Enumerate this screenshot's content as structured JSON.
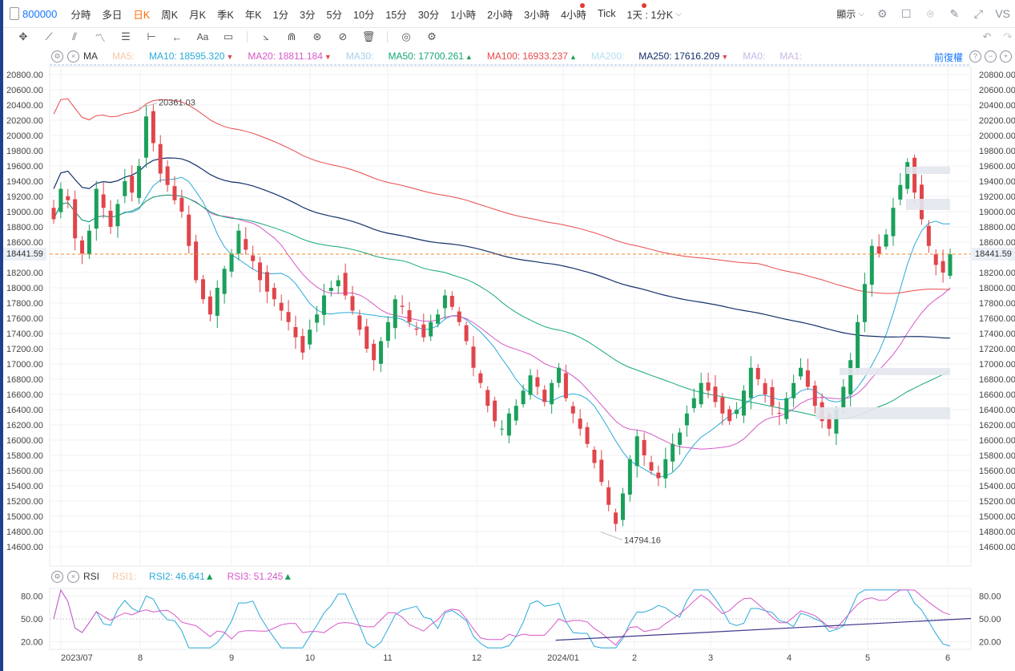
{
  "topbar": {
    "symbol": "800000",
    "periods": [
      {
        "label": "分時",
        "active": false
      },
      {
        "label": "多日",
        "active": false
      },
      {
        "label": "日K",
        "active": true
      },
      {
        "label": "周K",
        "active": false
      },
      {
        "label": "月K",
        "active": false
      },
      {
        "label": "季K",
        "active": false
      },
      {
        "label": "年K",
        "active": false
      },
      {
        "label": "1分",
        "active": false
      },
      {
        "label": "3分",
        "active": false
      },
      {
        "label": "5分",
        "active": false
      },
      {
        "label": "10分",
        "active": false
      },
      {
        "label": "15分",
        "active": false
      },
      {
        "label": "30分",
        "active": false
      },
      {
        "label": "1小時",
        "active": false
      },
      {
        "label": "2小時",
        "active": false
      },
      {
        "label": "3小時",
        "active": false
      },
      {
        "label": "4小時",
        "active": false
      },
      {
        "label": "Tick",
        "active": false
      }
    ],
    "interval_select": "1天 : 1分K",
    "display_select": "顯示",
    "vs_label": "VS"
  },
  "toolbar": {
    "tools": [
      "crosshair-icon",
      "trendline-icon",
      "channel-icon",
      "pattern-icon",
      "fib-icon",
      "measure-icon",
      "arrow-icon",
      "text-icon",
      "comment-icon",
      "ruler-icon",
      "magnet-icon",
      "lock-icon",
      "hide-icon",
      "trash-icon",
      "visibility-icon",
      "settings-icon"
    ]
  },
  "main_legend": {
    "indicator": "MA",
    "items": [
      {
        "label": "MA5:",
        "value": "",
        "color": "#f6c6a8",
        "dir": ""
      },
      {
        "label": "MA10:",
        "value": "18595.320",
        "color": "#2aaad8",
        "dir": "down"
      },
      {
        "label": "MA20:",
        "value": "18811.184",
        "color": "#d658c8",
        "dir": "down"
      },
      {
        "label": "MA30:",
        "value": "",
        "color": "#a8cde8",
        "dir": ""
      },
      {
        "label": "MA50:",
        "value": "17700.261",
        "color": "#14a874",
        "dir": "up"
      },
      {
        "label": "MA100:",
        "value": "16933.237",
        "color": "#e84a4a",
        "dir": "up"
      },
      {
        "label": "MA200:",
        "value": "",
        "color": "#b6dff0",
        "dir": ""
      },
      {
        "label": "MA250:",
        "value": "17616.209",
        "color": "#14306a",
        "dir": "down"
      },
      {
        "label": "MA0:",
        "value": "",
        "color": "#c9b8e6",
        "dir": ""
      },
      {
        "label": "MA1:",
        "value": "",
        "color": "#c9b8e6",
        "dir": ""
      }
    ],
    "adjust_label": "前復權"
  },
  "rsi_legend": {
    "indicator": "RSI",
    "items": [
      {
        "label": "RSI1:",
        "value": "",
        "color": "#f6c6a8",
        "dir": ""
      },
      {
        "label": "RSI2:",
        "value": "46.641",
        "color": "#2aaad8",
        "dir": "up"
      },
      {
        "label": "RSI3:",
        "value": "51.245",
        "color": "#d658c8",
        "dir": "up"
      }
    ]
  },
  "chart_data": [
    {
      "type": "candlestick",
      "title": "",
      "ylim": [
        14400,
        20900
      ],
      "y_ticks": [
        "20800.00",
        "20600.00",
        "20400.00",
        "20200.00",
        "20000.00",
        "19800.00",
        "19600.00",
        "19400.00",
        "19200.00",
        "19000.00",
        "18800.00",
        "18600.00",
        "18400.00",
        "18200.00",
        "18000.00",
        "17800.00",
        "17600.00",
        "17400.00",
        "17200.00",
        "17000.00",
        "16800.00",
        "16600.00",
        "16400.00",
        "16200.00",
        "16000.00",
        "15800.00",
        "15600.00",
        "15400.00",
        "15200.00",
        "15000.00",
        "14800.00",
        "14600.00"
      ],
      "x_ticks": [
        "2023/07",
        "8",
        "9",
        "10",
        "11",
        "12",
        "2024/01",
        "2",
        "3",
        "4",
        "5",
        "6"
      ],
      "current_price": "18441.59",
      "annotations": [
        {
          "label": "20361.03",
          "value": 20361.03,
          "kind": "high"
        },
        {
          "label": "14794.16",
          "value": 14794.16,
          "kind": "low"
        }
      ],
      "up_color": "#1aa05a",
      "down_color": "#e0454b",
      "closes": [
        18900,
        19300,
        19150,
        18650,
        18450,
        18750,
        19300,
        19050,
        18800,
        19100,
        19400,
        19250,
        19600,
        20250,
        19900,
        19500,
        19350,
        19150,
        19000,
        18550,
        18100,
        17850,
        17650,
        18000,
        18250,
        18450,
        18750,
        18500,
        18350,
        18100,
        17950,
        17850,
        17700,
        17550,
        17350,
        17150,
        17450,
        17650,
        17900,
        18000,
        18100,
        17900,
        17700,
        17450,
        17200,
        17050,
        17300,
        17550,
        17850,
        17750,
        17550,
        17450,
        17350,
        17550,
        17650,
        17900,
        17750,
        17550,
        17300,
        16950,
        16750,
        16450,
        16250,
        16150,
        16350,
        16450,
        16650,
        16850,
        16700,
        16500,
        16750,
        16950,
        16550,
        16350,
        16150,
        15950,
        15700,
        15450,
        15150,
        14900,
        15300,
        15750,
        16050,
        15800,
        15600,
        15500,
        15750,
        15950,
        16100,
        16350,
        16550,
        16750,
        16650,
        16500,
        16350,
        16250,
        16400,
        16650,
        16950,
        16800,
        16600,
        16450,
        16350,
        16550,
        16750,
        16950,
        16700,
        16450,
        16250,
        16150,
        16400,
        16700,
        17050,
        17550,
        18050,
        18550,
        18450,
        18700,
        19050,
        19350,
        19650,
        19250,
        18900,
        18550,
        18300,
        18200,
        18441.59
      ]
    },
    {
      "type": "line",
      "title": "RSI",
      "ylim": [
        10,
        90
      ],
      "y_ticks": [
        "80.00",
        "50.00",
        "20.00"
      ],
      "series": [
        {
          "name": "RSI2",
          "color": "#2aaad8"
        },
        {
          "name": "RSI3",
          "color": "#d658c8"
        }
      ],
      "trendline": {
        "from": [
          0.56,
          22
        ],
        "to": [
          1.0,
          50.5
        ],
        "color": "#3f3a8c"
      }
    }
  ]
}
